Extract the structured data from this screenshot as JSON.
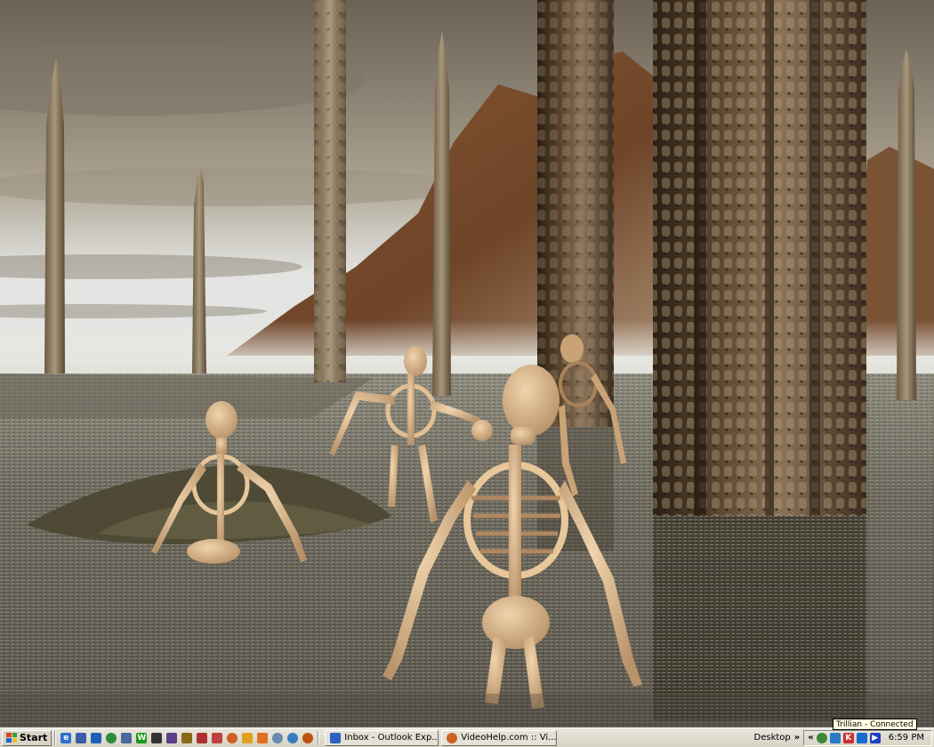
{
  "taskbar": {
    "start_label": "Start",
    "quick_launch": [
      {
        "icon": "internet-explorer-icon",
        "color": "#2f6fd0"
      },
      {
        "icon": "show-desktop-icon",
        "color": "#3a5fa8"
      },
      {
        "icon": "outlook-icon",
        "color": "#1d5fb8"
      },
      {
        "icon": "globe-icon",
        "color": "#2b8a3e"
      },
      {
        "icon": "network-icon",
        "color": "#4a6a9a"
      },
      {
        "icon": "winamp-icon",
        "color": "#1a9c1a"
      },
      {
        "icon": "terminal-icon",
        "color": "#333333"
      },
      {
        "icon": "media-player-icon",
        "color": "#5a3e8a"
      },
      {
        "icon": "gear-app-icon",
        "color": "#8a6a1a"
      },
      {
        "icon": "chart-app-icon",
        "color": "#b03030"
      },
      {
        "icon": "paint-icon",
        "color": "#c04040"
      },
      {
        "icon": "firefox-icon",
        "color": "#d06020"
      },
      {
        "icon": "folder-icon",
        "color": "#e0a020"
      },
      {
        "icon": "notepad-icon",
        "color": "#e07020"
      },
      {
        "icon": "clock-app-icon",
        "color": "#6a8ab0"
      },
      {
        "icon": "search-icon",
        "color": "#3a7ac0"
      },
      {
        "icon": "browser-icon",
        "color": "#c05010"
      }
    ],
    "tasks": [
      {
        "label": "Inbox - Outlook Exp...",
        "icon": "outlook-express-icon"
      },
      {
        "label": "VideoHelp.com :: Vi...",
        "icon": "firefox-icon"
      }
    ],
    "desktop_toolbar_label": "Desktop",
    "chevron": "»",
    "tray_chevron": "«",
    "tray_icons": [
      {
        "icon": "trillian-tray-icon",
        "color": "#3a8a3a"
      },
      {
        "icon": "network-tray-icon",
        "color": "#2a7ac8"
      },
      {
        "icon": "antivirus-tray-icon",
        "color": "#c83030"
      },
      {
        "icon": "messenger-tray-icon",
        "color": "#1a6ad0"
      },
      {
        "icon": "media-tray-icon",
        "color": "#2040c0"
      }
    ],
    "clock": "6:59 PM",
    "tooltip": "Trillian - Connected"
  }
}
